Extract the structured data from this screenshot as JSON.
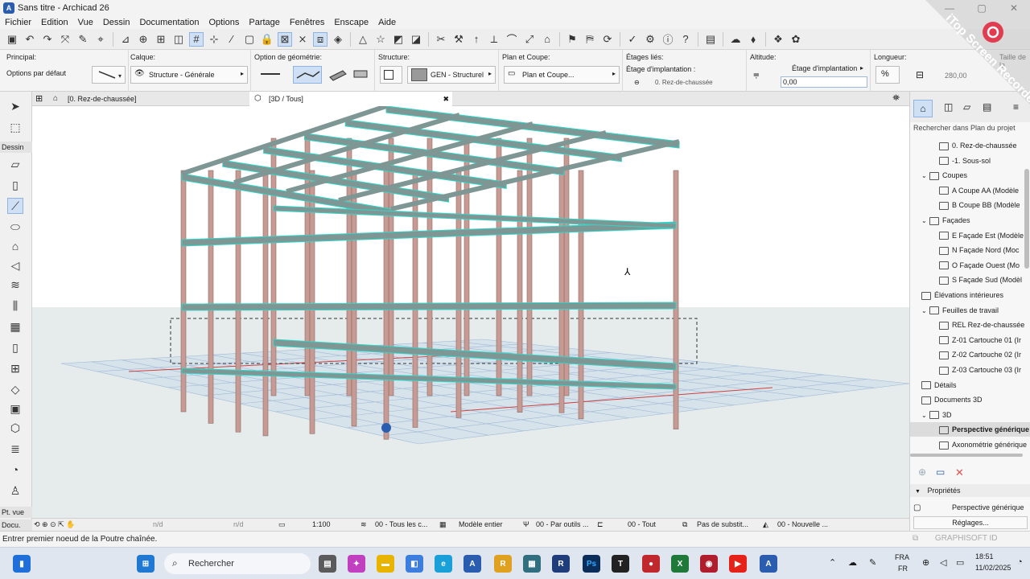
{
  "window": {
    "title": "Sans titre - Archicad 26",
    "min": "—",
    "max": "▢",
    "close": "✕"
  },
  "menu": [
    "Fichier",
    "Edition",
    "Vue",
    "Dessin",
    "Documentation",
    "Options",
    "Partage",
    "Fenêtres",
    "Enscape",
    "Aide"
  ],
  "infobox": {
    "principal_label": "Principal:",
    "principal_value": "Options par défaut",
    "calque_label": "Calque:",
    "calque_value": "Structure - Générale",
    "geometrie_label": "Option de géométrie:",
    "structure_label": "Structure:",
    "structure_value": "GEN - Structurel",
    "plan_label": "Plan et Coupe:",
    "plan_value": "Plan et Coupe...",
    "etages_label": "Étages liés:",
    "etages_value1": "Étage d'implantation :",
    "etages_value2": "0. Rez-de-chaussée",
    "altitude_label": "Altitude:",
    "altitude_ref": "Étage d'implantation",
    "altitude_value": "0,00",
    "longueur_label": "Longueur:",
    "longueur_value": "280,00",
    "taille_label": "Taille de la"
  },
  "tools": {
    "dessin_label": "Dessin",
    "ptvue_label": "Pt. vue",
    "docu_label": "Docu."
  },
  "tabs": {
    "plan": "[0. Rez-de-chaussée]",
    "view3d": "[3D / Tous]",
    "close": "✖"
  },
  "statusbar": {
    "nd1": "n/d",
    "nd2": "n/d",
    "scale": "1:100",
    "calques": "00 - Tous les c...",
    "modele": "Modèle entier",
    "outils": "00 - Par outils ...",
    "tout": "00 - Tout",
    "substit": "Pas de substit...",
    "nouvelle": "00 - Nouvelle ..."
  },
  "message": "Entrer premier noeud de la Poutre chaînée.",
  "navigator": {
    "search_placeholder": "Rechercher dans Plan du projet",
    "items": [
      {
        "label": "0. Rez-de-chaussée",
        "indent": 2
      },
      {
        "label": "-1. Sous-sol",
        "indent": 2
      },
      {
        "label": "Coupes",
        "indent": 1,
        "expanded": true
      },
      {
        "label": "A Coupe AA (Modèle",
        "indent": 2
      },
      {
        "label": "B Coupe BB (Modèle",
        "indent": 2
      },
      {
        "label": "Façades",
        "indent": 1,
        "expanded": true
      },
      {
        "label": "E Façade Est (Modèle",
        "indent": 2
      },
      {
        "label": "N Façade Nord (Moc",
        "indent": 2
      },
      {
        "label": "O Façade Ouest (Mo",
        "indent": 2
      },
      {
        "label": "S Façade Sud (Modèl",
        "indent": 2
      },
      {
        "label": "Élévations intérieures",
        "indent": 1
      },
      {
        "label": "Feuilles de travail",
        "indent": 1,
        "expanded": true
      },
      {
        "label": "REL Rez-de-chaussée",
        "indent": 2
      },
      {
        "label": "Z-01 Cartouche 01 (Ir",
        "indent": 2
      },
      {
        "label": "Z-02 Cartouche 02 (Ir",
        "indent": 2
      },
      {
        "label": "Z-03 Cartouche 03 (Ir",
        "indent": 2
      },
      {
        "label": "Détails",
        "indent": 1
      },
      {
        "label": "Documents 3D",
        "indent": 1
      },
      {
        "label": "3D",
        "indent": 1,
        "expanded": true
      },
      {
        "label": "Perspective générique",
        "indent": 2,
        "selected": true
      },
      {
        "label": "Axonométrie générique",
        "indent": 2
      }
    ],
    "proprietes_label": "Propriétés",
    "prop_value": "Perspective générique",
    "reglages": "Réglages...",
    "graphisoft": "GRAPHISOFT ID"
  },
  "taskbar": {
    "search": "Rechercher",
    "lang1": "FRA",
    "lang2": "FR",
    "time": "18:51",
    "date": "11/02/2025"
  },
  "watermark": "iTop Screen Recorder",
  "colors": {
    "beam": "#7f9794",
    "column": "#c79a94",
    "edge": "#2fd6c8",
    "accent": "#2a5db0"
  }
}
